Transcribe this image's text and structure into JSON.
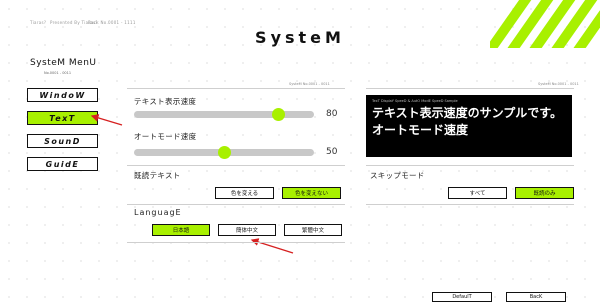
{
  "header": {
    "top_texts": [
      "Tiaras?",
      "Presented By Tiaras?",
      "Back No.0001 - 1111"
    ],
    "title": "SysteM"
  },
  "menu": {
    "title": "SysteM MenU",
    "subtitle": "No.0001 - 0011",
    "items": [
      {
        "label": "WindoW",
        "active": false
      },
      {
        "label": "TexT",
        "active": true
      },
      {
        "label": "SounD",
        "active": false
      },
      {
        "label": "GuidE",
        "active": false
      }
    ]
  },
  "panel_tags": {
    "left": "SysteM No.0001 - 0011",
    "right": "SysteM No.0001 - 0011"
  },
  "text_speed": {
    "label": "テキスト表示速度",
    "value": 80
  },
  "auto_speed": {
    "label": "オートモード速度",
    "value": 50
  },
  "read_text": {
    "label": "既読テキスト",
    "options": [
      "色を変える",
      "色を変えない"
    ],
    "selected": 1
  },
  "language": {
    "label": "LanguagE",
    "options": [
      "日本語",
      "簡体中文",
      "繁體中文"
    ],
    "selected": 0
  },
  "skip_mode": {
    "label": "スキップモード",
    "options": [
      "すべて",
      "既読のみ"
    ],
    "selected": 1
  },
  "sample": {
    "caption": "TexT DisplaY SpeeD & AutO ModE SpeeD Sample",
    "line1": "テキスト表示速度のサンプルです。",
    "line2": "オートモード速度"
  },
  "bottom_buttons": [
    "DefaulT",
    "BacK"
  ],
  "colors": {
    "accent": "#a8f000",
    "arrow": "#d62020"
  }
}
